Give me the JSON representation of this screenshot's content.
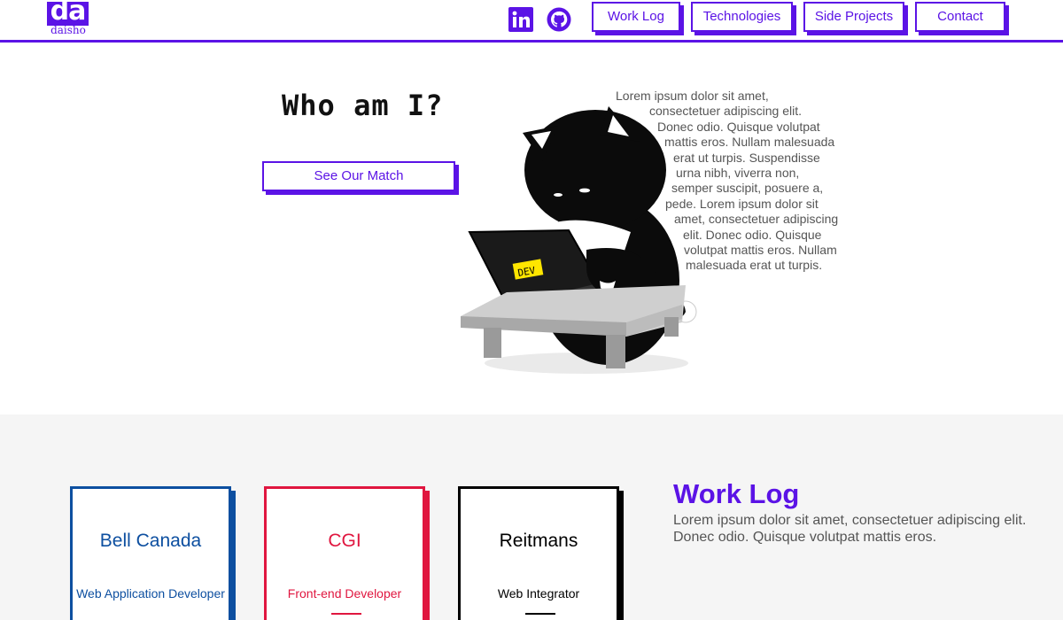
{
  "brand": {
    "logo_mark": "da",
    "logo_name": "daisho",
    "accent_color": "#5b13e6"
  },
  "social": [
    {
      "name": "linkedin-icon"
    },
    {
      "name": "github-icon"
    }
  ],
  "nav": {
    "items": [
      "Work Log",
      "Technologies",
      "Side Projects",
      "Contact"
    ]
  },
  "hero": {
    "title": "Who am I?",
    "cta_label": "See Our Match",
    "laptop_sticker": "DEV",
    "text_lines": [
      "Lorem ipsum dolor sit amet,",
      "consectetuer adipiscing elit.",
      "Donec odio. Quisque volutpat",
      "mattis eros. Nullam malesuada",
      "erat ut turpis. Suspendisse",
      "urna nibh, viverra non,",
      "semper suscipit, posuere a,",
      "pede. Lorem ipsum dolor sit",
      "amet, consectetuer adipiscing",
      "elit. Donec odio. Quisque",
      "volutpat mattis eros. Nullam",
      "malesuada erat ut turpis."
    ]
  },
  "work_log": {
    "title": "Work Log",
    "description": "Lorem ipsum dolor sit amet, consectetuer adipiscing elit. Donec odio. Quisque volutpat mattis eros.",
    "cards": [
      {
        "company": "Bell Canada",
        "role": "Web Application Developer",
        "color": "#0d4fa0"
      },
      {
        "company": "CGI",
        "role": "Front-end Developer",
        "color": "#e0163f"
      },
      {
        "company": "Reitmans",
        "role": "Web Integrator",
        "color": "#000000"
      }
    ]
  }
}
